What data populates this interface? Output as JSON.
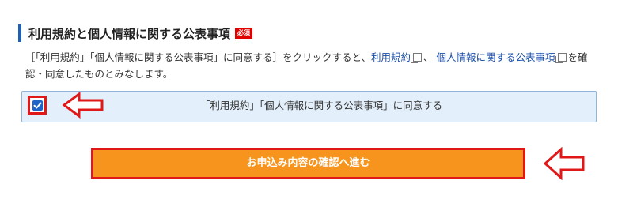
{
  "section": {
    "title": "利用規約と個人情報に関する公表事項",
    "required_badge": "必須"
  },
  "notice": {
    "text_before": "［「利用規約」「個人情報に関する公表事項」に同意する］をクリックすると、",
    "link_terms": "利用規約",
    "separator": "、",
    "link_privacy": "個人情報に関する公表事項",
    "text_after": "を確認・同意したものとみなします。"
  },
  "agreement": {
    "checked": true,
    "label": "「利用規約」「個人情報に関する公表事項」に同意する"
  },
  "submit": {
    "label": "お申込み内容の確認へ進む"
  },
  "colors": {
    "accent_blue": "#1f5fb8",
    "annotation_red": "#e01818",
    "button_orange": "#f7941d",
    "agree_bg": "#e3f0fb"
  },
  "icons": [
    "external-window-icon",
    "checkmark-icon",
    "pointer-arrow-icon"
  ]
}
